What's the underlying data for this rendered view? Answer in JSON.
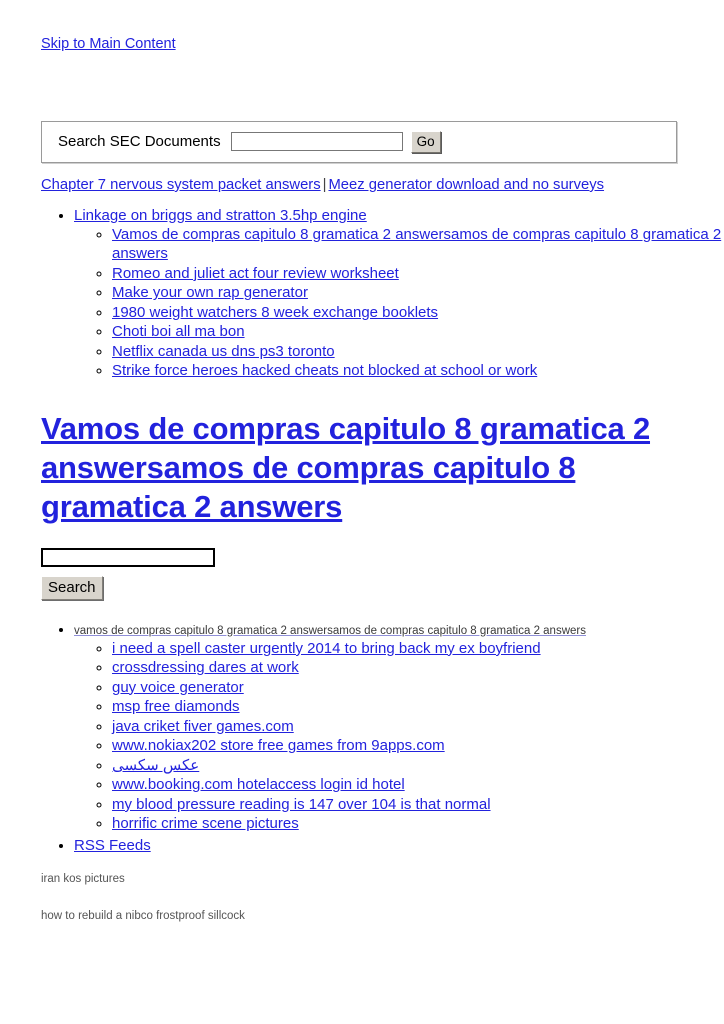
{
  "skip": {
    "label": "Skip to Main Content"
  },
  "sec_search": {
    "label": "Search SEC Documents",
    "input_value": "",
    "input_placeholder": "",
    "go_label": "Go"
  },
  "crumbs": {
    "left_label": "Chapter 7 nervous system packet answers",
    "separator": "|",
    "right_label": "Meez generator download and no surveys"
  },
  "list_one": {
    "parent_label": "Linkage on briggs and stratton 3.5hp engine",
    "children": [
      "Vamos de compras capitulo 8 gramatica 2 answersamos de compras capitulo 8 gramatica 2 answers",
      "Romeo and juliet act four review worksheet",
      "Make your own rap generator",
      "1980 weight watchers 8 week exchange booklets",
      "Choti boi all ma bon",
      "Netflix canada us dns ps3 toronto",
      "Strike force heroes hacked cheats not blocked at school or work"
    ]
  },
  "headline": {
    "label": "Vamos de compras capitulo 8 gramatica 2 answersamos de compras capitulo 8 gramatica 2 answers"
  },
  "search_form": {
    "input_value": "",
    "input_placeholder": "",
    "button_label": "Search"
  },
  "list_two": {
    "parent_label": "vamos de compras capitulo 8 gramatica 2 answersamos de compras capitulo 8 gramatica 2 answers",
    "children": [
      "i need a spell caster urgently 2014 to bring back my ex boyfriend",
      "crossdressing dares at work",
      "guy voice generator",
      "msp free diamonds",
      "java criket fiver games.com",
      "www.nokiax202 store free games from 9apps.com",
      "عکس سکسی",
      "www.booking.com hotelaccess login id hotel",
      "my blood pressure reading is 147 over 104 is that normal",
      "horrific crime scene pictures"
    ],
    "rss_label": "RSS Feeds"
  },
  "footer": {
    "line_one": "iran kos pictures",
    "line_two": "how to rebuild a nibco frostproof sillcock"
  },
  "colors": {
    "link": "#2222dd",
    "text": "#000000",
    "muted": "#555555",
    "button_face": "#d8d4cc",
    "panel_border": "#9a9a9a"
  }
}
